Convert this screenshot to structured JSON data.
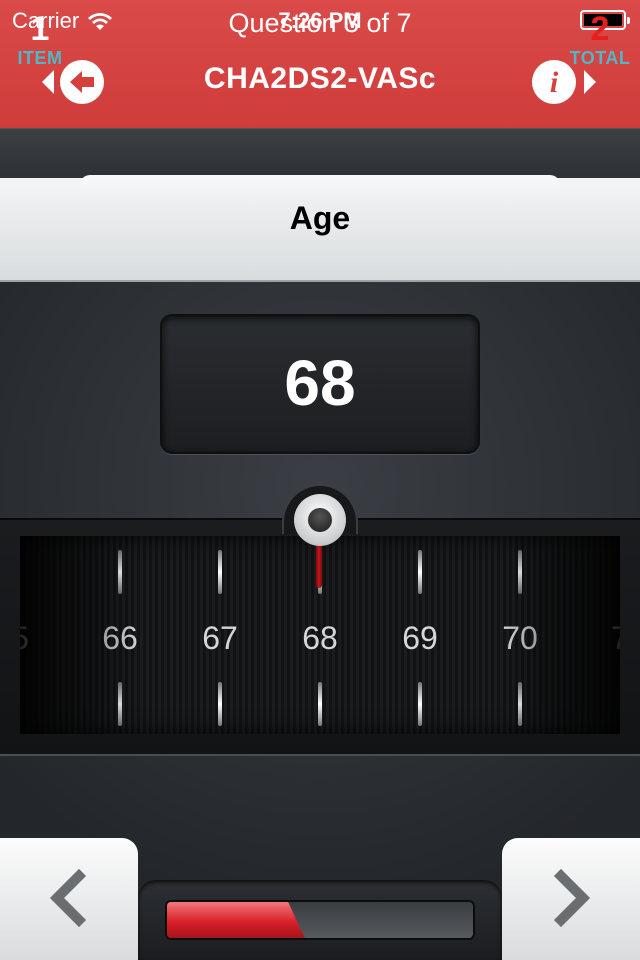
{
  "status_bar": {
    "carrier": "Carrier",
    "time": "7:26 PM"
  },
  "nav": {
    "title": "CHA2DS2-VASc",
    "back_icon": "back-arrow-icon",
    "info_icon": "info-icon"
  },
  "question": {
    "progress_text": "Question 3 of 7",
    "title": "Age",
    "item_count": "1",
    "item_label": "ITEM",
    "total_count": "2",
    "total_label": "TOTAL"
  },
  "dial": {
    "value": "68",
    "ticks": [
      "5",
      "66",
      "67",
      "68",
      "69",
      "70",
      "7"
    ]
  },
  "footer": {
    "prev_icon": "chevron-left-icon",
    "next_icon": "chevron-right-icon",
    "progress_fraction": 0.45
  },
  "colors": {
    "nav_red": "#d3403e",
    "accent_cyan": "#4fb7c6",
    "total_red": "#e81d1d",
    "progress_red": "#d8202a"
  }
}
